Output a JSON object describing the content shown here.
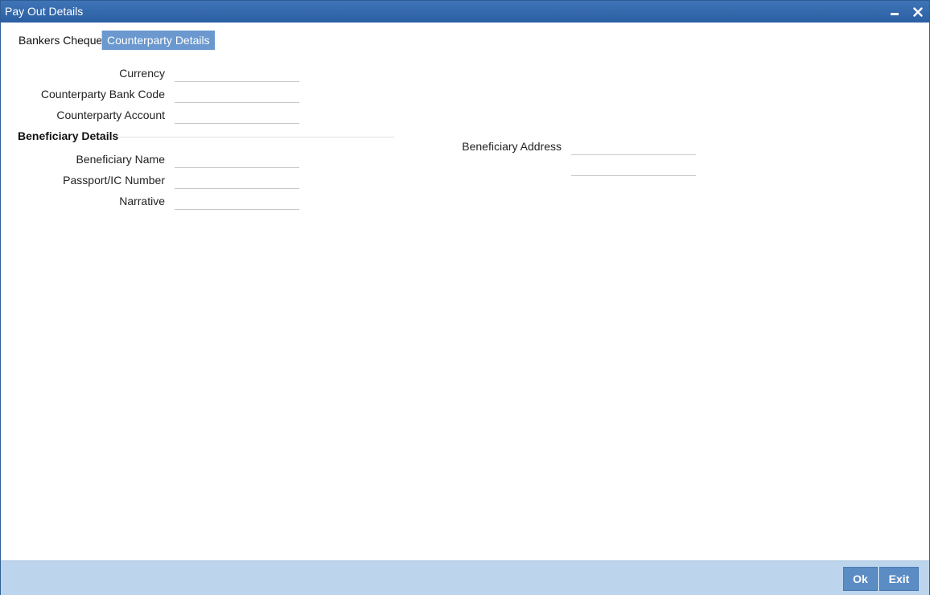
{
  "window": {
    "title": "Pay Out Details"
  },
  "tabs": [
    {
      "label": "Bankers Cheque",
      "active": false
    },
    {
      "label": "Counterparty Details",
      "active": true
    }
  ],
  "form": {
    "currency": {
      "label": "Currency",
      "value": ""
    },
    "counterparty_bank_code": {
      "label": "Counterparty Bank Code",
      "value": ""
    },
    "counterparty_account": {
      "label": "Counterparty Account",
      "value": ""
    },
    "beneficiary_section": {
      "title": "Beneficiary Details"
    },
    "beneficiary_name": {
      "label": "Beneficiary Name",
      "value": ""
    },
    "passport_ic_number": {
      "label": "Passport/IC Number",
      "value": ""
    },
    "narrative": {
      "label": "Narrative",
      "value": ""
    },
    "beneficiary_address": {
      "label": "Beneficiary Address",
      "line1": "",
      "line2": ""
    }
  },
  "footer": {
    "ok_label": "Ok",
    "exit_label": "Exit"
  },
  "colors": {
    "titlebar": "#2b5fa3",
    "active_tab": "#6a98cf",
    "footer": "#bcd5ec",
    "button": "#5b8cc4"
  }
}
